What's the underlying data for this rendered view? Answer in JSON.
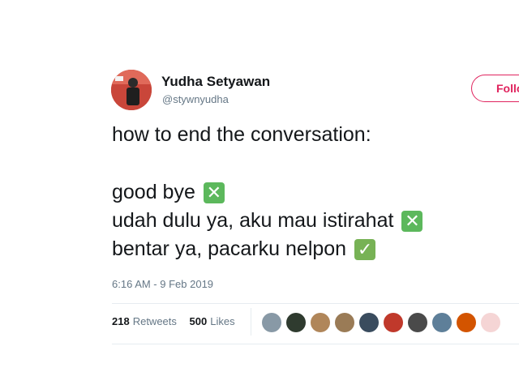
{
  "author": {
    "name": "Yudha Setyawan",
    "handle": "@stywnyudha"
  },
  "follow_button": {
    "label": "Follow"
  },
  "tweet": {
    "lines": [
      {
        "text": "how to end the conversation:"
      },
      {
        "text": "good bye",
        "mark": "cross-mark-icon"
      },
      {
        "text": "udah dulu ya, aku mau istirahat",
        "mark": "cross-mark-icon"
      },
      {
        "text": "bentar ya, pacarku nelpon",
        "mark": "check-mark-icon"
      }
    ],
    "timestamp": "6:16 AM - 9 Feb 2019"
  },
  "stats": {
    "retweets_count": "218",
    "retweets_label": "Retweets",
    "likes_count": "500",
    "likes_label": "Likes"
  },
  "liker_avatars": [
    {
      "icon": "avatar-placeholder",
      "color": "#8899a6"
    },
    {
      "icon": "avatar",
      "color": "#2f3b2f"
    },
    {
      "icon": "avatar",
      "color": "#b0865a"
    },
    {
      "icon": "avatar",
      "color": "#9a7b56"
    },
    {
      "icon": "avatar",
      "color": "#3a4c5e"
    },
    {
      "icon": "avatar",
      "color": "#c0392b"
    },
    {
      "icon": "avatar",
      "color": "#4a4a4a"
    },
    {
      "icon": "avatar",
      "color": "#5e7f99"
    },
    {
      "icon": "avatar",
      "color": "#d35400"
    },
    {
      "icon": "avatar",
      "color": "#f5d5d5"
    }
  ],
  "colors": {
    "follow_accent": "#e0245e",
    "cross_mark_bg": "#5cb85c",
    "check_mark_bg": "#77b255"
  }
}
